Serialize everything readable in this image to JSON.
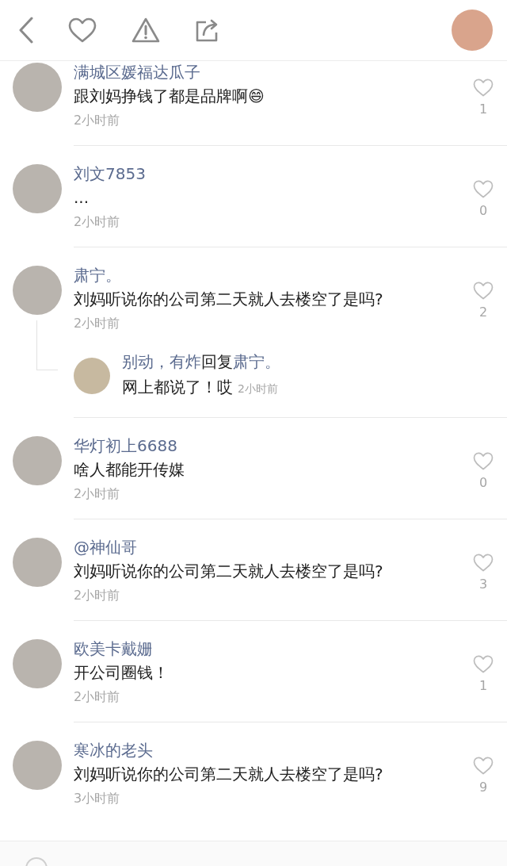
{
  "comments": [
    {
      "author": "满城区媛福达瓜子",
      "text": "跟刘妈挣钱了都是品牌啊😄",
      "time": "2小时前",
      "likes": "1"
    },
    {
      "author": "刘文7853",
      "text": "...",
      "time": "2小时前",
      "likes": "0"
    },
    {
      "author": "肃宁。",
      "text": "刘妈听说你的公司第二天就人去楼空了是吗?",
      "time": "2小时前",
      "likes": "2",
      "replies": [
        {
          "author": "别动，有炸",
          "action": "回复",
          "target": "肃宁。",
          "text": "网上都说了！哎",
          "time": "2小时前"
        }
      ]
    },
    {
      "author": "华灯初上6688",
      "text": "啥人都能开传媒",
      "time": "2小时前",
      "likes": "0"
    },
    {
      "author": "@神仙哥",
      "text": "刘妈听说你的公司第二天就人去楼空了是吗?",
      "time": "2小时前",
      "likes": "3"
    },
    {
      "author": "欧美卡戴姗",
      "text": "开公司圈钱！",
      "time": "2小时前",
      "likes": "1"
    },
    {
      "author": "寒冰的老头",
      "text": "刘妈听说你的公司第二天就人去楼空了是吗?",
      "time": "3小时前",
      "likes": "9"
    }
  ]
}
